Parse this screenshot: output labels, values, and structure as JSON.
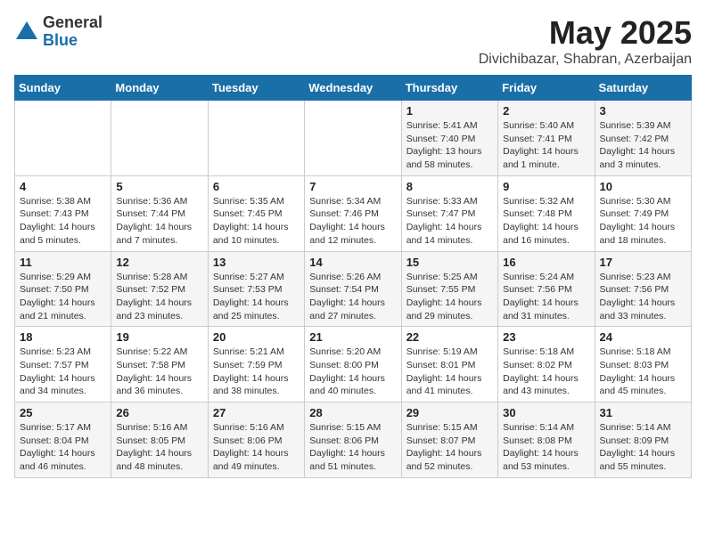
{
  "header": {
    "logo_general": "General",
    "logo_blue": "Blue",
    "title": "May 2025",
    "location": "Divichibazar, Shabran, Azerbaijan"
  },
  "weekdays": [
    "Sunday",
    "Monday",
    "Tuesday",
    "Wednesday",
    "Thursday",
    "Friday",
    "Saturday"
  ],
  "weeks": [
    [
      {
        "num": "",
        "sunrise": "",
        "sunset": "",
        "daylight": ""
      },
      {
        "num": "",
        "sunrise": "",
        "sunset": "",
        "daylight": ""
      },
      {
        "num": "",
        "sunrise": "",
        "sunset": "",
        "daylight": ""
      },
      {
        "num": "",
        "sunrise": "",
        "sunset": "",
        "daylight": ""
      },
      {
        "num": "1",
        "sunrise": "Sunrise: 5:41 AM",
        "sunset": "Sunset: 7:40 PM",
        "daylight": "Daylight: 13 hours and 58 minutes."
      },
      {
        "num": "2",
        "sunrise": "Sunrise: 5:40 AM",
        "sunset": "Sunset: 7:41 PM",
        "daylight": "Daylight: 14 hours and 1 minute."
      },
      {
        "num": "3",
        "sunrise": "Sunrise: 5:39 AM",
        "sunset": "Sunset: 7:42 PM",
        "daylight": "Daylight: 14 hours and 3 minutes."
      }
    ],
    [
      {
        "num": "4",
        "sunrise": "Sunrise: 5:38 AM",
        "sunset": "Sunset: 7:43 PM",
        "daylight": "Daylight: 14 hours and 5 minutes."
      },
      {
        "num": "5",
        "sunrise": "Sunrise: 5:36 AM",
        "sunset": "Sunset: 7:44 PM",
        "daylight": "Daylight: 14 hours and 7 minutes."
      },
      {
        "num": "6",
        "sunrise": "Sunrise: 5:35 AM",
        "sunset": "Sunset: 7:45 PM",
        "daylight": "Daylight: 14 hours and 10 minutes."
      },
      {
        "num": "7",
        "sunrise": "Sunrise: 5:34 AM",
        "sunset": "Sunset: 7:46 PM",
        "daylight": "Daylight: 14 hours and 12 minutes."
      },
      {
        "num": "8",
        "sunrise": "Sunrise: 5:33 AM",
        "sunset": "Sunset: 7:47 PM",
        "daylight": "Daylight: 14 hours and 14 minutes."
      },
      {
        "num": "9",
        "sunrise": "Sunrise: 5:32 AM",
        "sunset": "Sunset: 7:48 PM",
        "daylight": "Daylight: 14 hours and 16 minutes."
      },
      {
        "num": "10",
        "sunrise": "Sunrise: 5:30 AM",
        "sunset": "Sunset: 7:49 PM",
        "daylight": "Daylight: 14 hours and 18 minutes."
      }
    ],
    [
      {
        "num": "11",
        "sunrise": "Sunrise: 5:29 AM",
        "sunset": "Sunset: 7:50 PM",
        "daylight": "Daylight: 14 hours and 21 minutes."
      },
      {
        "num": "12",
        "sunrise": "Sunrise: 5:28 AM",
        "sunset": "Sunset: 7:52 PM",
        "daylight": "Daylight: 14 hours and 23 minutes."
      },
      {
        "num": "13",
        "sunrise": "Sunrise: 5:27 AM",
        "sunset": "Sunset: 7:53 PM",
        "daylight": "Daylight: 14 hours and 25 minutes."
      },
      {
        "num": "14",
        "sunrise": "Sunrise: 5:26 AM",
        "sunset": "Sunset: 7:54 PM",
        "daylight": "Daylight: 14 hours and 27 minutes."
      },
      {
        "num": "15",
        "sunrise": "Sunrise: 5:25 AM",
        "sunset": "Sunset: 7:55 PM",
        "daylight": "Daylight: 14 hours and 29 minutes."
      },
      {
        "num": "16",
        "sunrise": "Sunrise: 5:24 AM",
        "sunset": "Sunset: 7:56 PM",
        "daylight": "Daylight: 14 hours and 31 minutes."
      },
      {
        "num": "17",
        "sunrise": "Sunrise: 5:23 AM",
        "sunset": "Sunset: 7:56 PM",
        "daylight": "Daylight: 14 hours and 33 minutes."
      }
    ],
    [
      {
        "num": "18",
        "sunrise": "Sunrise: 5:23 AM",
        "sunset": "Sunset: 7:57 PM",
        "daylight": "Daylight: 14 hours and 34 minutes."
      },
      {
        "num": "19",
        "sunrise": "Sunrise: 5:22 AM",
        "sunset": "Sunset: 7:58 PM",
        "daylight": "Daylight: 14 hours and 36 minutes."
      },
      {
        "num": "20",
        "sunrise": "Sunrise: 5:21 AM",
        "sunset": "Sunset: 7:59 PM",
        "daylight": "Daylight: 14 hours and 38 minutes."
      },
      {
        "num": "21",
        "sunrise": "Sunrise: 5:20 AM",
        "sunset": "Sunset: 8:00 PM",
        "daylight": "Daylight: 14 hours and 40 minutes."
      },
      {
        "num": "22",
        "sunrise": "Sunrise: 5:19 AM",
        "sunset": "Sunset: 8:01 PM",
        "daylight": "Daylight: 14 hours and 41 minutes."
      },
      {
        "num": "23",
        "sunrise": "Sunrise: 5:18 AM",
        "sunset": "Sunset: 8:02 PM",
        "daylight": "Daylight: 14 hours and 43 minutes."
      },
      {
        "num": "24",
        "sunrise": "Sunrise: 5:18 AM",
        "sunset": "Sunset: 8:03 PM",
        "daylight": "Daylight: 14 hours and 45 minutes."
      }
    ],
    [
      {
        "num": "25",
        "sunrise": "Sunrise: 5:17 AM",
        "sunset": "Sunset: 8:04 PM",
        "daylight": "Daylight: 14 hours and 46 minutes."
      },
      {
        "num": "26",
        "sunrise": "Sunrise: 5:16 AM",
        "sunset": "Sunset: 8:05 PM",
        "daylight": "Daylight: 14 hours and 48 minutes."
      },
      {
        "num": "27",
        "sunrise": "Sunrise: 5:16 AM",
        "sunset": "Sunset: 8:06 PM",
        "daylight": "Daylight: 14 hours and 49 minutes."
      },
      {
        "num": "28",
        "sunrise": "Sunrise: 5:15 AM",
        "sunset": "Sunset: 8:06 PM",
        "daylight": "Daylight: 14 hours and 51 minutes."
      },
      {
        "num": "29",
        "sunrise": "Sunrise: 5:15 AM",
        "sunset": "Sunset: 8:07 PM",
        "daylight": "Daylight: 14 hours and 52 minutes."
      },
      {
        "num": "30",
        "sunrise": "Sunrise: 5:14 AM",
        "sunset": "Sunset: 8:08 PM",
        "daylight": "Daylight: 14 hours and 53 minutes."
      },
      {
        "num": "31",
        "sunrise": "Sunrise: 5:14 AM",
        "sunset": "Sunset: 8:09 PM",
        "daylight": "Daylight: 14 hours and 55 minutes."
      }
    ]
  ]
}
